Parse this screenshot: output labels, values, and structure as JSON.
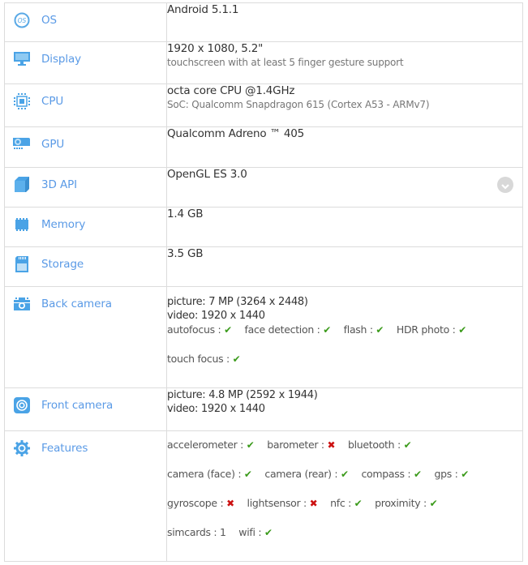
{
  "accent_color": "#5a9ae6",
  "check_color": "#3a9a1a",
  "cross_color": "#cc1111",
  "rows": {
    "os": {
      "label": "OS",
      "icon": "os-icon",
      "value": "Android 5.1.1"
    },
    "display": {
      "label": "Display",
      "icon": "monitor-icon",
      "value": "1920 x 1080, 5.2\"",
      "sub": "touchscreen with at least 5 finger gesture support"
    },
    "cpu": {
      "label": "CPU",
      "icon": "chip-icon",
      "value": "octa core CPU @1.4GHz",
      "sub": "SoC: Qualcomm Snapdragon 615 (Cortex A53 - ARMv7)"
    },
    "gpu": {
      "label": "GPU",
      "icon": "graphics-card-icon",
      "value": "Qualcomm Adreno ™ 405"
    },
    "api3d": {
      "label": "3D API",
      "icon": "cube-icon",
      "value": "OpenGL ES 3.0",
      "expand_icon": "chevron-down-icon"
    },
    "memory": {
      "label": "Memory",
      "icon": "ram-icon",
      "value": "1.4 GB"
    },
    "storage": {
      "label": "Storage",
      "icon": "sd-card-icon",
      "value": "3.5 GB"
    },
    "back_camera": {
      "label": "Back camera",
      "icon": "camera-icon",
      "picture": "picture: 7 MP (3264 x 2448)",
      "video": "video: 1920 x 1440",
      "features": [
        {
          "name": "autofocus :",
          "status": "✔"
        },
        {
          "name": "face detection :",
          "status": "✔"
        },
        {
          "name": "flash :",
          "status": "✔"
        },
        {
          "name": "HDR photo :",
          "status": "✔"
        },
        {
          "name": "touch focus :",
          "status": "✔"
        }
      ]
    },
    "front_camera": {
      "label": "Front camera",
      "icon": "front-camera-icon",
      "picture": "picture: 4.8 MP (2592 x 1944)",
      "video": "video: 1920 x 1440"
    },
    "features": {
      "label": "Features",
      "icon": "gear-icon",
      "items": [
        {
          "name": "accelerometer :",
          "status": "✔"
        },
        {
          "name": "barometer :",
          "status": "✖"
        },
        {
          "name": "bluetooth :",
          "status": "✔"
        },
        {
          "name": "camera (face) :",
          "status": "✔"
        },
        {
          "name": "camera (rear) :",
          "status": "✔"
        },
        {
          "name": "compass :",
          "status": "✔"
        },
        {
          "name": "gps :",
          "status": "✔"
        },
        {
          "name": "gyroscope :",
          "status": "✖"
        },
        {
          "name": "lightsensor :",
          "status": "✖"
        },
        {
          "name": "nfc :",
          "status": "✔"
        },
        {
          "name": "proximity :",
          "status": "✔"
        },
        {
          "name": "simcards :",
          "status": "1"
        },
        {
          "name": "wifi :",
          "status": "✔"
        }
      ]
    }
  }
}
